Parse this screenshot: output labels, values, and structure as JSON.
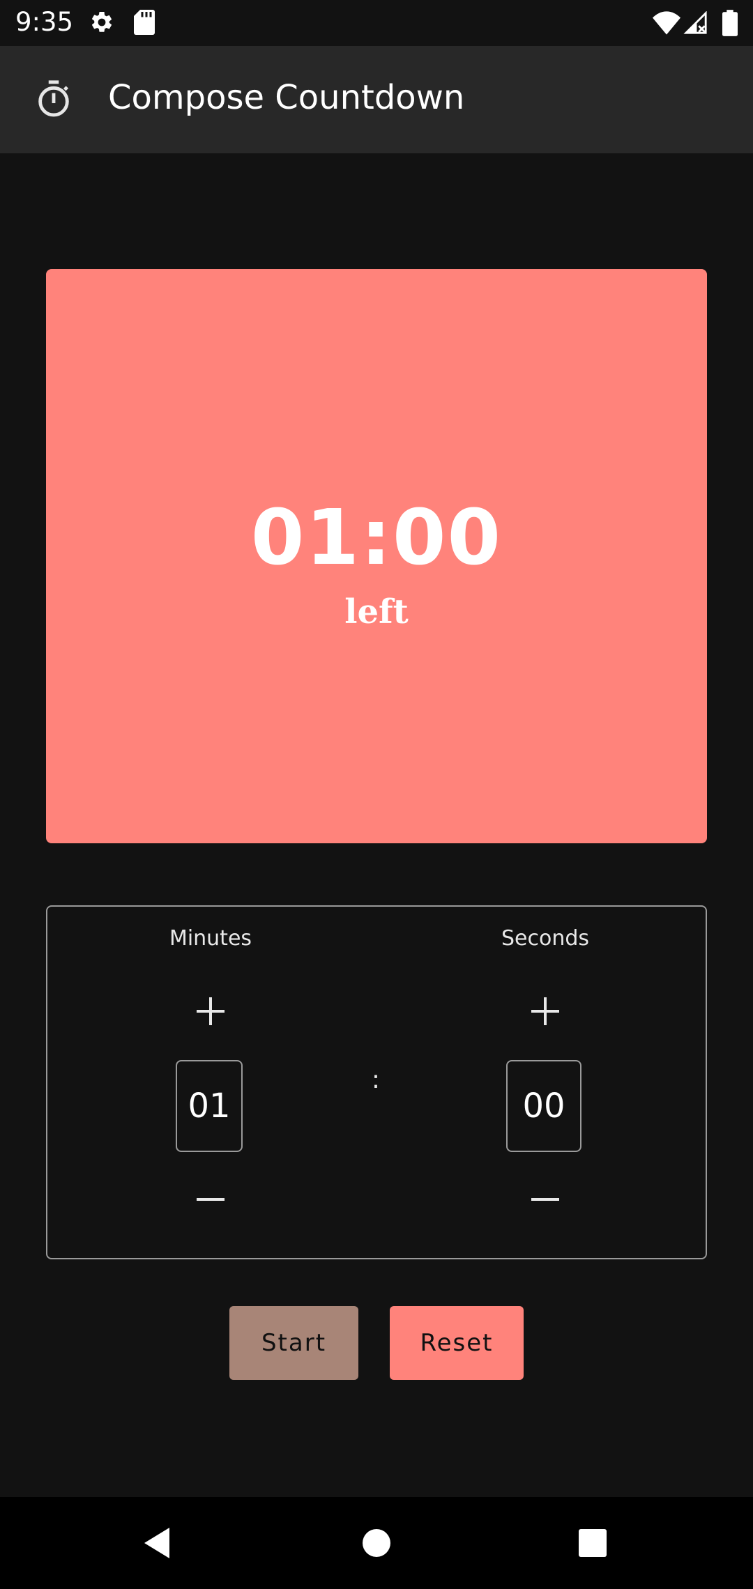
{
  "status_bar": {
    "time": "9:35",
    "icons": [
      "settings-icon",
      "sd-card-icon",
      "wifi-icon",
      "cell-signal-icon",
      "battery-icon"
    ]
  },
  "app_bar": {
    "icon": "timer-icon",
    "title": "Compose Countdown"
  },
  "timer_display": {
    "time": "01:00",
    "caption": "left",
    "background_color": "#ff837b"
  },
  "picker": {
    "minutes": {
      "label": "Minutes",
      "value": "01",
      "increment_symbol": "+",
      "decrement_symbol": "—"
    },
    "separator": ":",
    "seconds": {
      "label": "Seconds",
      "value": "00",
      "increment_symbol": "+",
      "decrement_symbol": "—"
    }
  },
  "actions": {
    "start_label": "Start",
    "reset_label": "Reset",
    "start_color": "#a88577",
    "reset_color": "#ff837b"
  },
  "nav_bar": {
    "icons": [
      "back-icon",
      "home-icon",
      "recents-icon"
    ]
  }
}
